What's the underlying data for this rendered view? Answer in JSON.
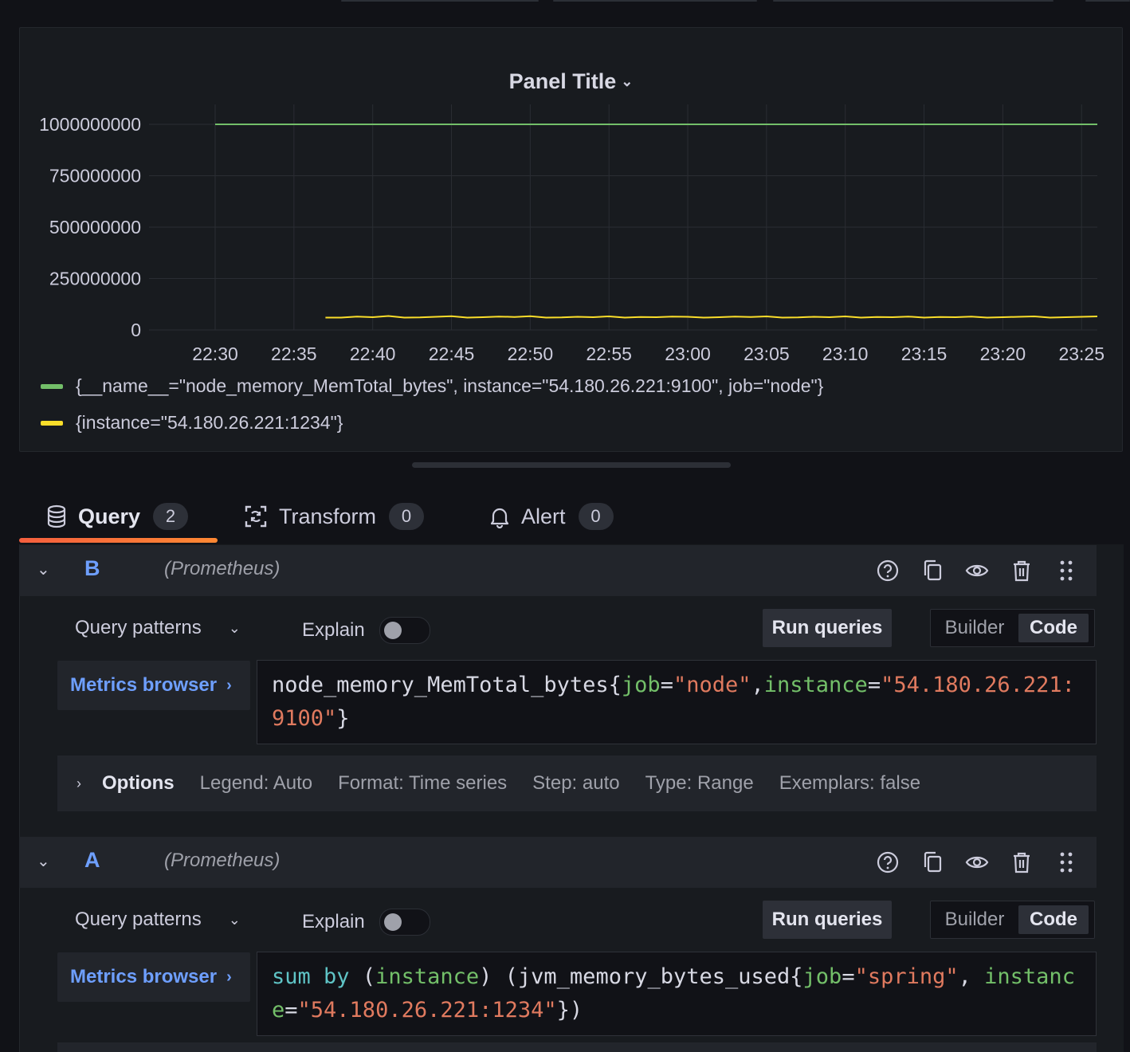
{
  "panel": {
    "title": "Panel Title",
    "legend": [
      {
        "label": "{__name__=\"node_memory_MemTotal_bytes\", instance=\"54.180.26.221:9100\", job=\"node\"}",
        "color": "#73bf69"
      },
      {
        "label": "{instance=\"54.180.26.221:1234\"}",
        "color": "#fade2a"
      }
    ]
  },
  "chart_data": {
    "type": "line",
    "x_ticks": [
      "22:30",
      "22:35",
      "22:40",
      "22:45",
      "22:50",
      "22:55",
      "23:00",
      "23:05",
      "23:10",
      "23:15",
      "23:20",
      "23:25"
    ],
    "y_ticks": [
      "1000000000",
      "750000000",
      "500000000",
      "250000000",
      "0"
    ],
    "ylim": [
      0,
      1000000000
    ],
    "xlim": [
      "22:30",
      "23:26"
    ],
    "grid": true,
    "legend_position": "bottom",
    "series": [
      {
        "name": "{__name__=\"node_memory_MemTotal_bytes\", instance=\"54.180.26.221:9100\", job=\"node\"}",
        "color": "#73bf69",
        "x": [
          "22:30",
          "23:26"
        ],
        "y": [
          1000000000,
          1000000000
        ]
      },
      {
        "name": "{instance=\"54.180.26.221:1234\"}",
        "color": "#fade2a",
        "x": [
          "22:37",
          "22:38",
          "22:39",
          "22:40",
          "22:41",
          "22:42",
          "22:43",
          "22:44",
          "22:45",
          "22:46",
          "22:47",
          "22:48",
          "22:49",
          "22:50",
          "22:51",
          "22:52",
          "22:53",
          "22:54",
          "22:55",
          "22:56",
          "22:57",
          "22:58",
          "22:59",
          "23:00",
          "23:01",
          "23:02",
          "23:03",
          "23:04",
          "23:05",
          "23:06",
          "23:07",
          "23:08",
          "23:09",
          "23:10",
          "23:11",
          "23:12",
          "23:13",
          "23:14",
          "23:15",
          "23:16",
          "23:17",
          "23:18",
          "23:19",
          "23:20",
          "23:21",
          "23:22",
          "23:23",
          "23:24",
          "23:25",
          "23:26"
        ],
        "y": [
          60000000,
          60000000,
          65000000,
          62000000,
          68000000,
          60000000,
          61000000,
          64000000,
          67000000,
          60000000,
          62000000,
          65000000,
          63000000,
          67000000,
          60000000,
          61000000,
          64000000,
          62000000,
          66000000,
          60000000,
          63000000,
          62000000,
          65000000,
          64000000,
          60000000,
          62000000,
          65000000,
          63000000,
          66000000,
          60000000,
          61000000,
          64000000,
          62000000,
          66000000,
          60000000,
          63000000,
          62000000,
          65000000,
          60000000,
          63000000,
          62000000,
          65000000,
          60000000,
          62000000,
          64000000,
          66000000,
          60000000,
          62000000,
          64000000,
          66000000
        ]
      }
    ]
  },
  "tabs": [
    {
      "label": "Query",
      "count": "2",
      "icon": "database-icon"
    },
    {
      "label": "Transform",
      "count": "0",
      "icon": "transform-icon"
    },
    {
      "label": "Alert",
      "count": "0",
      "icon": "bell-icon"
    }
  ],
  "queries": [
    {
      "refid": "B",
      "datasource": "(Prometheus)",
      "query_patterns": "Query patterns",
      "explain": "Explain",
      "run": "Run queries",
      "builder": "Builder",
      "code": "Code",
      "metrics_browser": "Metrics browser",
      "expression": "node_memory_MemTotal_bytes{job=\"node\",instance=\"54.180.26.221:9100\"}",
      "options": {
        "title": "Options",
        "legend": "Legend: Auto",
        "format": "Format: Time series",
        "step": "Step: auto",
        "type": "Type: Range",
        "exemplars": "Exemplars: false"
      }
    },
    {
      "refid": "A",
      "datasource": "(Prometheus)",
      "query_patterns": "Query patterns",
      "explain": "Explain",
      "run": "Run queries",
      "builder": "Builder",
      "code": "Code",
      "metrics_browser": "Metrics browser",
      "expression": "sum by (instance) (jvm_memory_bytes_used{job=\"spring\", instance=\"54.180.26.221:1234\"})"
    }
  ]
}
